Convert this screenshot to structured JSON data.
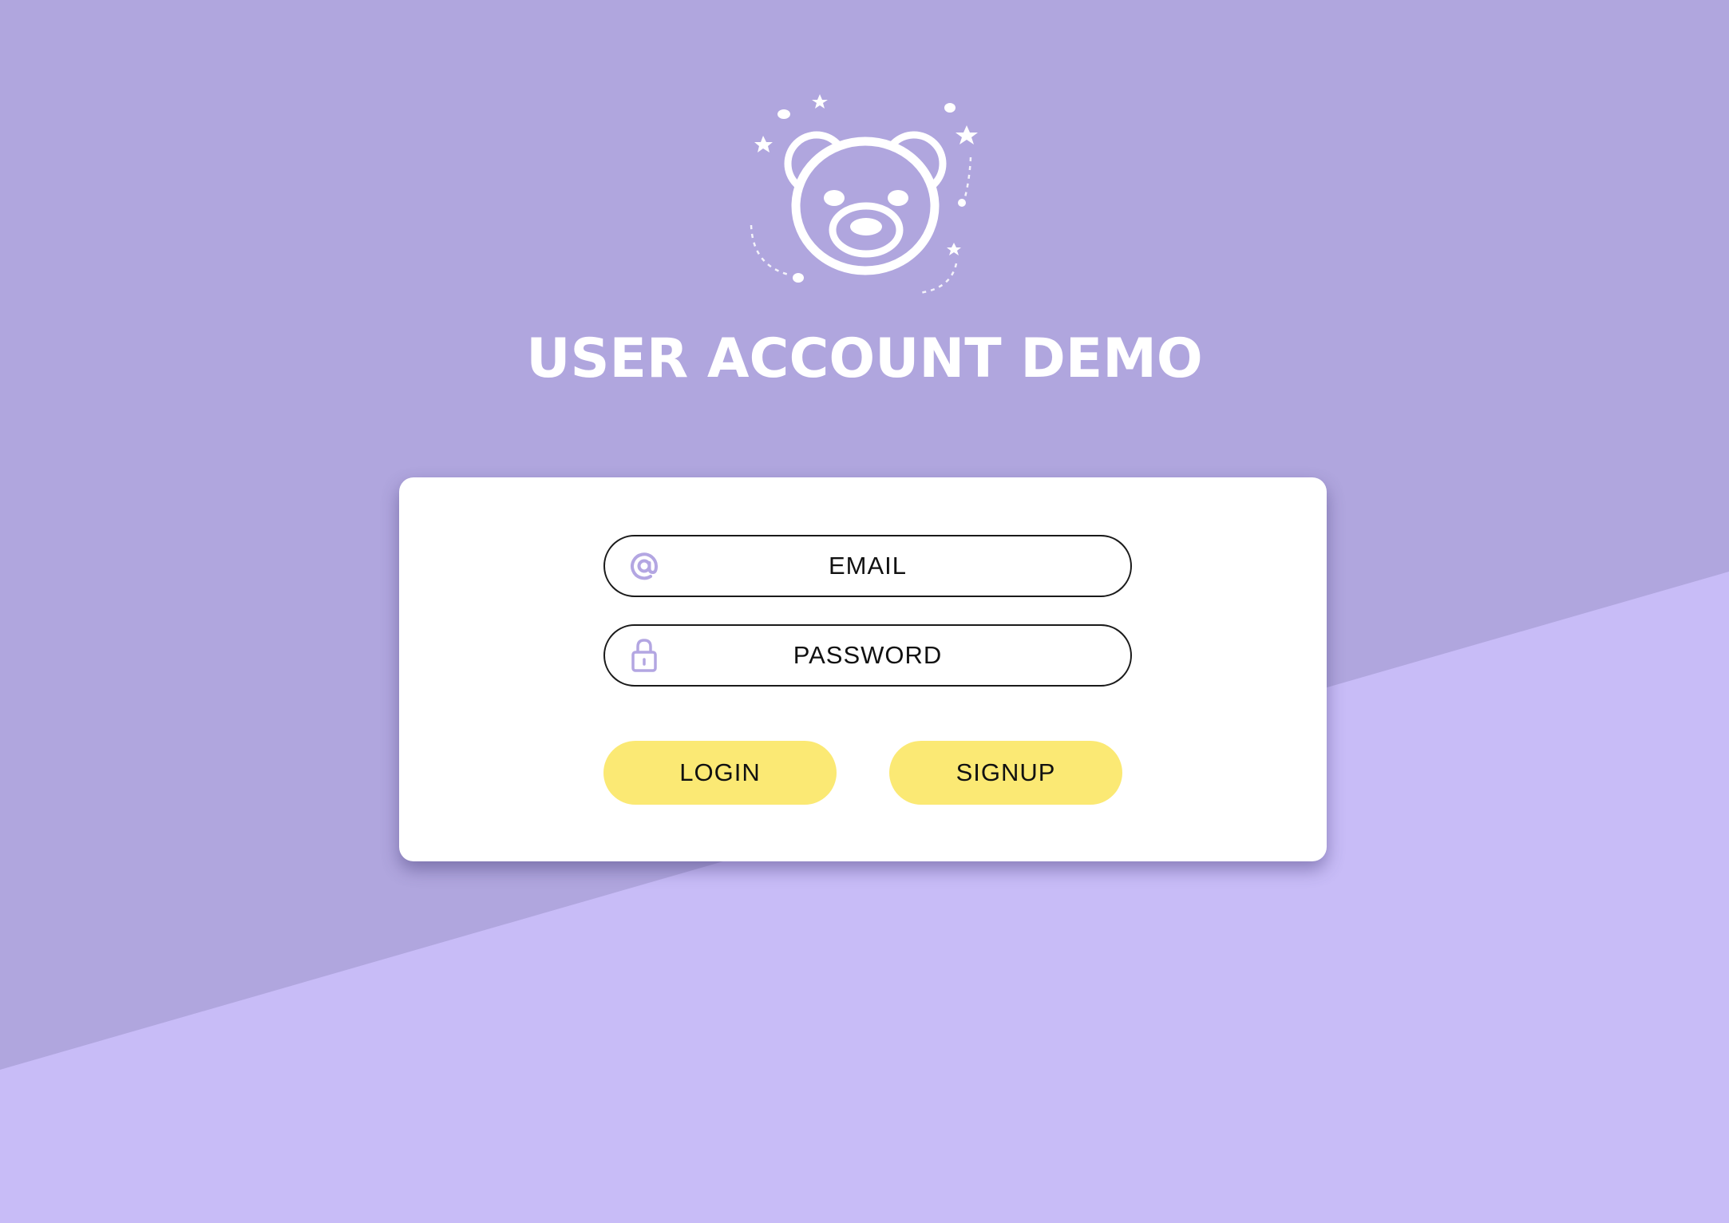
{
  "app": {
    "title": "USER ACCOUNT DEMO",
    "logo_icon": "teddy-bear-icon"
  },
  "colors": {
    "background_top": "#b0a6de",
    "background_bottom": "#c8bcf7",
    "card": "#ffffff",
    "button": "#fbe974",
    "icon_accent": "#b3a6e2"
  },
  "form": {
    "email": {
      "placeholder": "EMAIL",
      "value": "",
      "icon": "at-sign-icon"
    },
    "password": {
      "placeholder": "PASSWORD",
      "value": "",
      "icon": "lock-icon"
    },
    "login_label": "LOGIN",
    "signup_label": "SIGNUP"
  }
}
